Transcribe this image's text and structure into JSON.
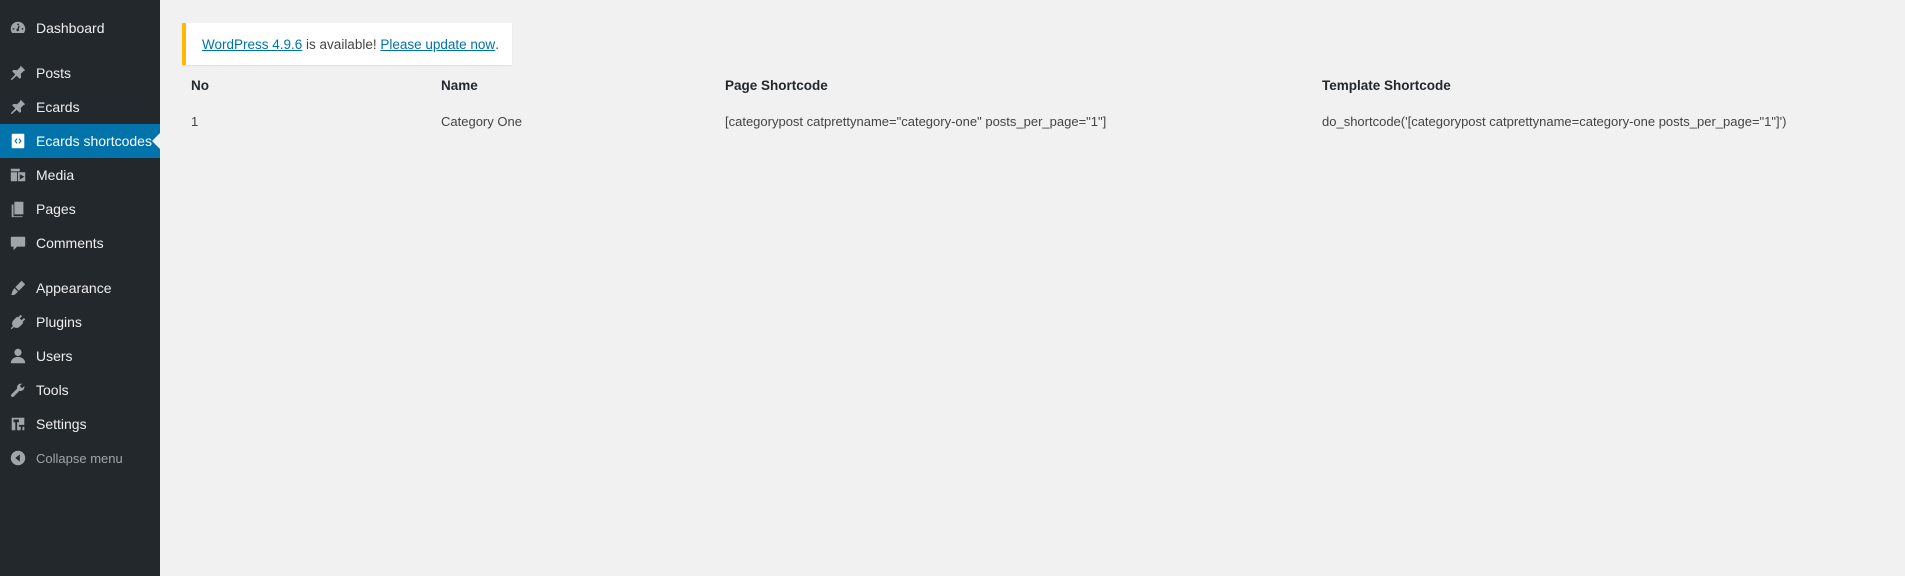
{
  "sidebar": {
    "items": [
      {
        "label": "Dashboard",
        "icon": "dashboard-icon"
      },
      {
        "label": "Posts",
        "icon": "pin-icon"
      },
      {
        "label": "Ecards",
        "icon": "pin-icon"
      },
      {
        "label": "Ecards shortcodes",
        "icon": "code-icon",
        "current": true
      },
      {
        "label": "Media",
        "icon": "media-icon"
      },
      {
        "label": "Pages",
        "icon": "pages-icon"
      },
      {
        "label": "Comments",
        "icon": "comment-icon"
      },
      {
        "label": "Appearance",
        "icon": "brush-icon"
      },
      {
        "label": "Plugins",
        "icon": "plugin-icon"
      },
      {
        "label": "Users",
        "icon": "user-icon"
      },
      {
        "label": "Tools",
        "icon": "wrench-icon"
      },
      {
        "label": "Settings",
        "icon": "settings-icon"
      }
    ],
    "collapse_label": "Collapse menu"
  },
  "notice": {
    "link_version": "WordPress 4.9.6",
    "middle_text": " is available! ",
    "link_update": "Please update now",
    "end_text": "."
  },
  "table": {
    "headers": [
      "No",
      "Name",
      "Page Shortcode",
      "Template Shortcode"
    ],
    "rows": [
      [
        "1",
        "Category One",
        "[categorypost catprettyname=\"category-one\" posts_per_page=\"1\"]",
        "do_shortcode('[categorypost catprettyname=category-one posts_per_page=\"1\"]')"
      ]
    ]
  },
  "colors": {
    "sidebar_bg": "#23282d",
    "accent": "#0073aa",
    "notice_border": "#ffb900",
    "page_bg": "#f1f1f1"
  }
}
